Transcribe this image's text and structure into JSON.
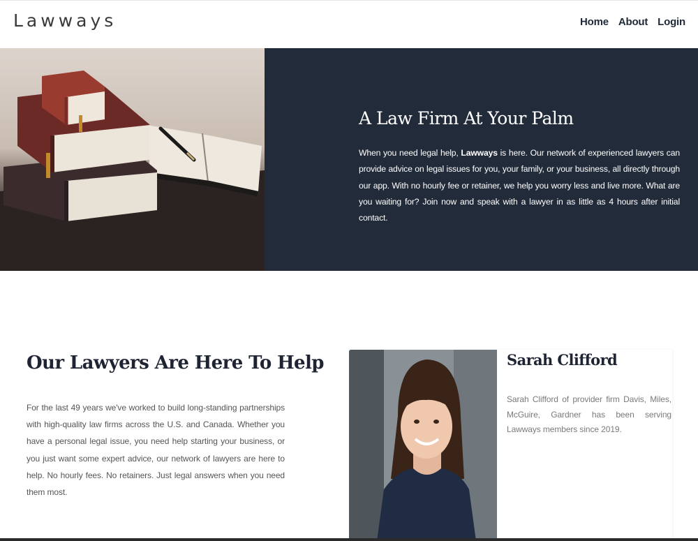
{
  "nav": {
    "brand": "Lawways",
    "links": [
      "Home",
      "About",
      "Login"
    ]
  },
  "hero": {
    "image_alt": "stack-of-law-books-with-pen",
    "title": "A Law Firm At Your Palm",
    "body_before": "When you need legal help, ",
    "body_brand": "Lawways",
    "body_after": " is here. Our network of experienced lawyers can provide advice on legal issues for you, your family, or your business, all directly through our app. With no hourly fee or retainer, we help you worry less and live more. What are you waiting for? Join now and speak with a lawyer in as little as 4 hours after initial contact."
  },
  "help": {
    "title": "Our Lawyers Are Here To Help",
    "body": "For the last 49 years we've worked to build long-standing partnerships with high-quality law firms across the U.S. and Canada. Whether you have a personal legal issue, you need help starting your business, or you just want some expert advice, our network of lawyers are here to help. No hourly fees. No retainers. Just legal answers when you need them most."
  },
  "lawyer": {
    "name": "Sarah Clifford",
    "bio": "Sarah Clifford of provider firm Davis, Miles, McGuire, Gardner has been serving Lawways members since 2019."
  },
  "colors": {
    "hero_bg": "#222b39",
    "heading": "#1f2433",
    "body_text": "#555555"
  }
}
